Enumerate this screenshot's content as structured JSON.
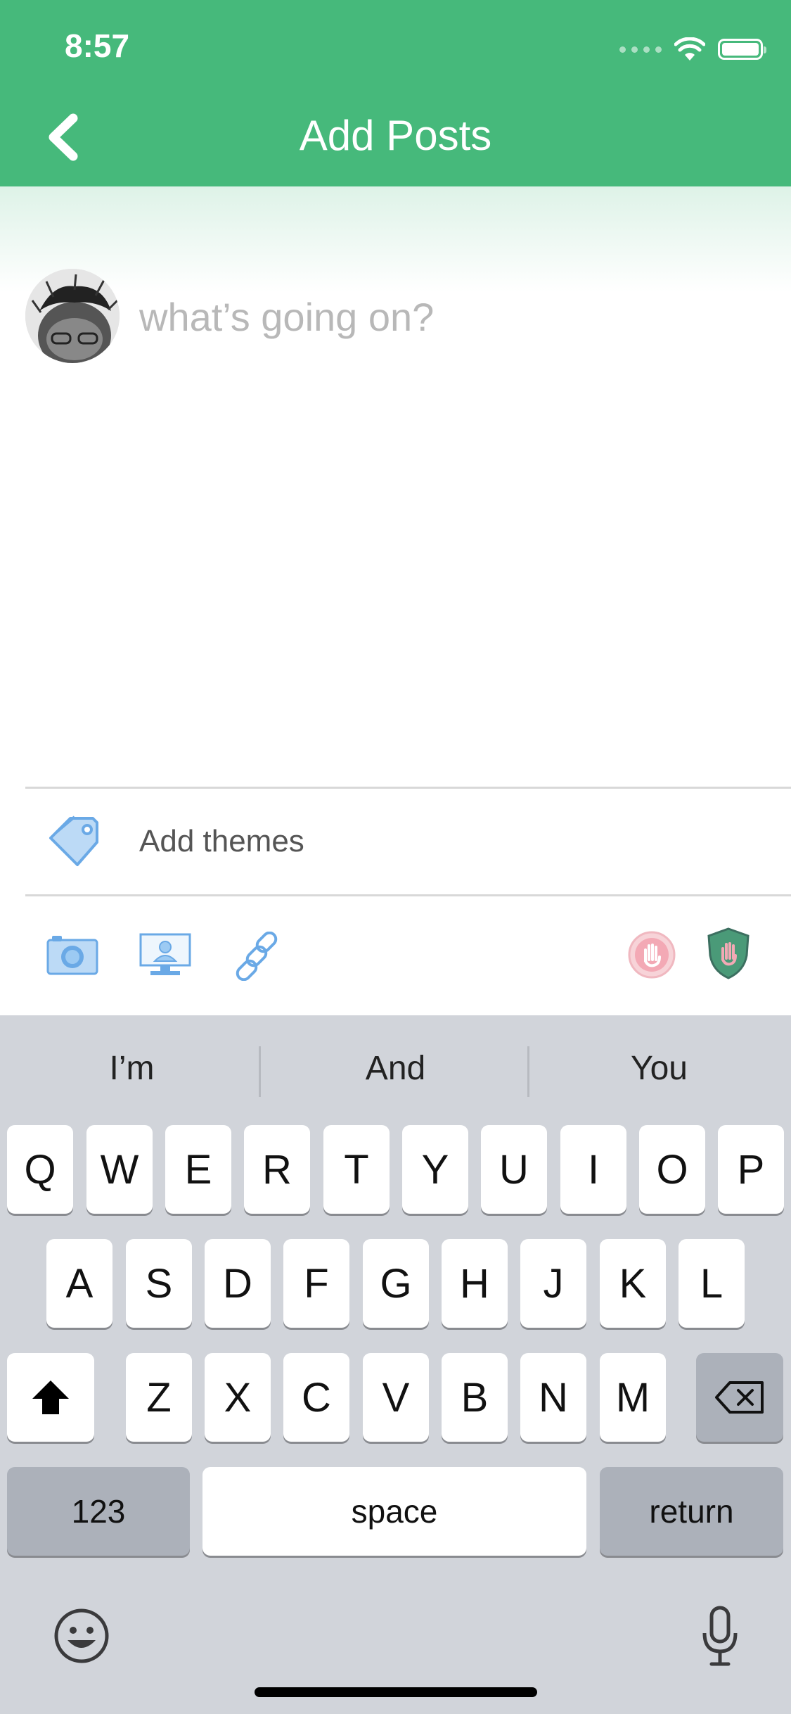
{
  "status_bar": {
    "time": "8:57"
  },
  "header": {
    "title": "Add Posts"
  },
  "composer": {
    "placeholder": "what’s going on?"
  },
  "themes": {
    "label": "Add themes"
  },
  "colors": {
    "header": "#46b97b",
    "icon_blue": "#6aa9e6",
    "keyboard_bg": "#d1d4da"
  },
  "keyboard": {
    "suggestions": [
      "I’m",
      "And",
      "You"
    ],
    "row1": [
      "Q",
      "W",
      "E",
      "R",
      "T",
      "Y",
      "U",
      "I",
      "O",
      "P"
    ],
    "row2": [
      "A",
      "S",
      "D",
      "F",
      "G",
      "H",
      "J",
      "K",
      "L"
    ],
    "row3": [
      "Z",
      "X",
      "C",
      "V",
      "B",
      "N",
      "M"
    ],
    "numbers_label": "123",
    "space_label": "space",
    "return_label": "return"
  }
}
